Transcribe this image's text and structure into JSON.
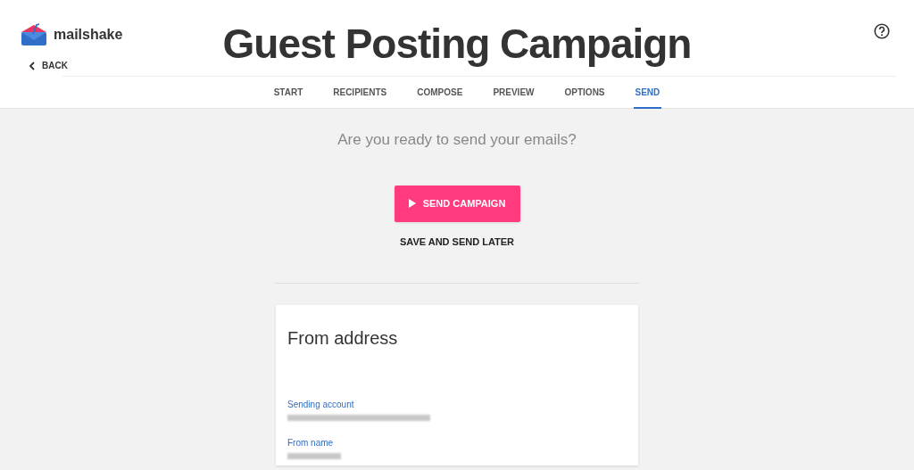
{
  "header": {
    "brand": "mailshake",
    "back": "BACK",
    "title": "Guest Posting Campaign"
  },
  "tabs": [
    {
      "label": "START",
      "selected": false
    },
    {
      "label": "RECIPIENTS",
      "selected": false
    },
    {
      "label": "COMPOSE",
      "selected": false
    },
    {
      "label": "PREVIEW",
      "selected": false
    },
    {
      "label": "OPTIONS",
      "selected": false
    },
    {
      "label": "SEND",
      "selected": true
    }
  ],
  "prompt": "Are you ready to send your emails?",
  "send_button": "SEND CAMPAIGN",
  "later_button": "SAVE AND SEND LATER",
  "card": {
    "title": "From address",
    "fields": [
      {
        "label": "Sending account",
        "redacted": true
      },
      {
        "label": "From name",
        "redacted": true
      }
    ]
  }
}
